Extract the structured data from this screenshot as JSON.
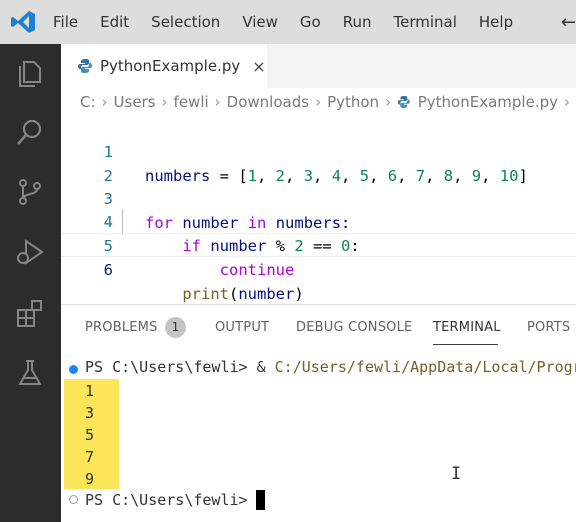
{
  "menu": {
    "items": [
      "File",
      "Edit",
      "Selection",
      "View",
      "Go",
      "Run",
      "Terminal",
      "Help"
    ],
    "back": "←"
  },
  "tab": {
    "label": "PythonExample.py",
    "close": "×"
  },
  "breadcrumb": {
    "items": [
      "C:",
      "Users",
      "fewli",
      "Downloads",
      "Python",
      "PythonExample.py"
    ],
    "separator": "›"
  },
  "code": {
    "lines": [
      {
        "num": "1",
        "text": "numbers = [1, 2, 3, 4, 5, 6, 7, 8, 9, 10]"
      },
      {
        "num": "2",
        "text": ""
      },
      {
        "num": "3",
        "text": "for number in numbers:"
      },
      {
        "num": "4",
        "text": "    if number % 2 == 0:"
      },
      {
        "num": "5",
        "text": "        continue"
      },
      {
        "num": "6",
        "text": "    print(number)"
      }
    ]
  },
  "panel": {
    "tabs": [
      "PROBLEMS",
      "OUTPUT",
      "DEBUG CONSOLE",
      "TERMINAL",
      "PORTS"
    ],
    "active_tab": "TERMINAL",
    "problems_count": "1"
  },
  "terminal": {
    "prompt1": "PS C:\\Users\\fewli> ",
    "command_amp": "& ",
    "command_path": "C:/Users/fewli/AppData/Local/Progr",
    "output": [
      "1",
      "3",
      "5",
      "7",
      "9"
    ],
    "prompt2": "PS C:\\Users\\fewli> "
  },
  "colors": {
    "activity_bar": "#2c2c2c",
    "title_bar": "#dddddd",
    "accent_blue": "#1a85ff",
    "output_highlight": "#fde55a"
  }
}
